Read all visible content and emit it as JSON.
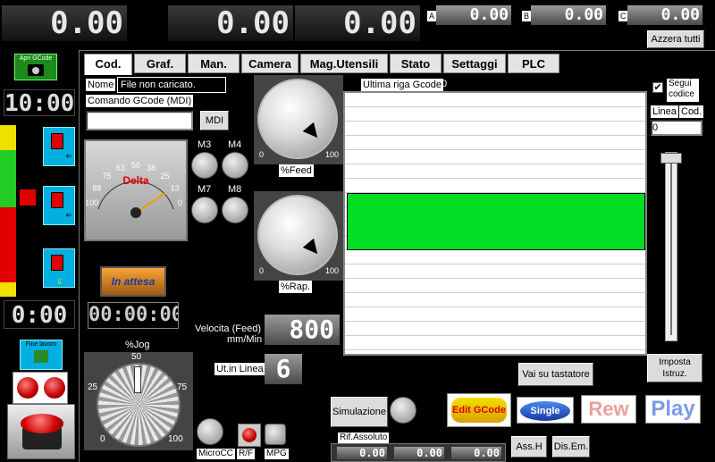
{
  "top": {
    "dro_x": "0.00",
    "dro_y": "0.00",
    "dro_z": "0.00",
    "axis_a_label": "A",
    "axis_a_value": "0.00",
    "axis_b_label": "B",
    "axis_b_value": "0.00",
    "axis_c_label": "C",
    "axis_c_value": "0.00",
    "reset_all": "Azzera tutti"
  },
  "left": {
    "open_gcode": "Apri GCode",
    "time_display": "10:00",
    "counter_display": "0:00",
    "end_work": "Fine lavoro"
  },
  "tabs": [
    "Cod.",
    "Graf.",
    "Man.",
    "Camera",
    "Mag.Utensili",
    "Stato",
    "Settaggi",
    "PLC"
  ],
  "code": {
    "name_label": "Nome",
    "name_value": "File non caricato.",
    "mdi_label": "Comando GCode (MDI)",
    "mdi_value": "",
    "mdi_button": "MDI",
    "last_line_label": "Ultima riga Gcode",
    "last_line_value": "0",
    "follow_label": "Segui codice",
    "line_label": "Linea",
    "code_label": "Cod.",
    "line_value": "0"
  },
  "gauge": {
    "brand": "Delta",
    "ticks": [
      "0",
      "13",
      "25",
      "38",
      "50",
      "63",
      "75",
      "88",
      "100"
    ],
    "needle_percent": 15
  },
  "m_buttons": [
    "M3",
    "M4",
    "M7",
    "M8"
  ],
  "feed": {
    "label": "%Feed",
    "min": "0",
    "max": "100"
  },
  "rapid": {
    "label": "%Rap.",
    "min": "0",
    "max": "100"
  },
  "status_badge": "In attesa",
  "elapsed_time": "00:00:00",
  "jog": {
    "label": "%Jog",
    "ticks": [
      "0",
      "25",
      "50",
      "75",
      "100"
    ]
  },
  "velocity": {
    "label_1": "Velocita (Feed)",
    "label_2": "mm/Min",
    "value": "800"
  },
  "tool_in_line": {
    "label": "Ut.in Linea",
    "value": "6"
  },
  "bottom": {
    "micro_cc": "MicroCC",
    "rf": "R/F",
    "mpg": "MPG",
    "simulation": "Simulazione",
    "abs_ref_label": "Rif.Assoluto",
    "abs_x": "0.00",
    "abs_y": "0.00",
    "abs_z": "0.00",
    "ass_h": "Ass.H",
    "dis_em": "Dis.Em.",
    "probe": "Vai su tastatore",
    "set_instr": "Imposta Istruz.",
    "edit_gcode": "Edit GCode",
    "single": "Single",
    "rew": "Rew",
    "play": "Play"
  },
  "colors": {
    "highlight_line": "#00dd22",
    "lamp_red": "#e00000",
    "lamp_green": "#22cc22",
    "lamp_yellow": "#f0e000"
  }
}
